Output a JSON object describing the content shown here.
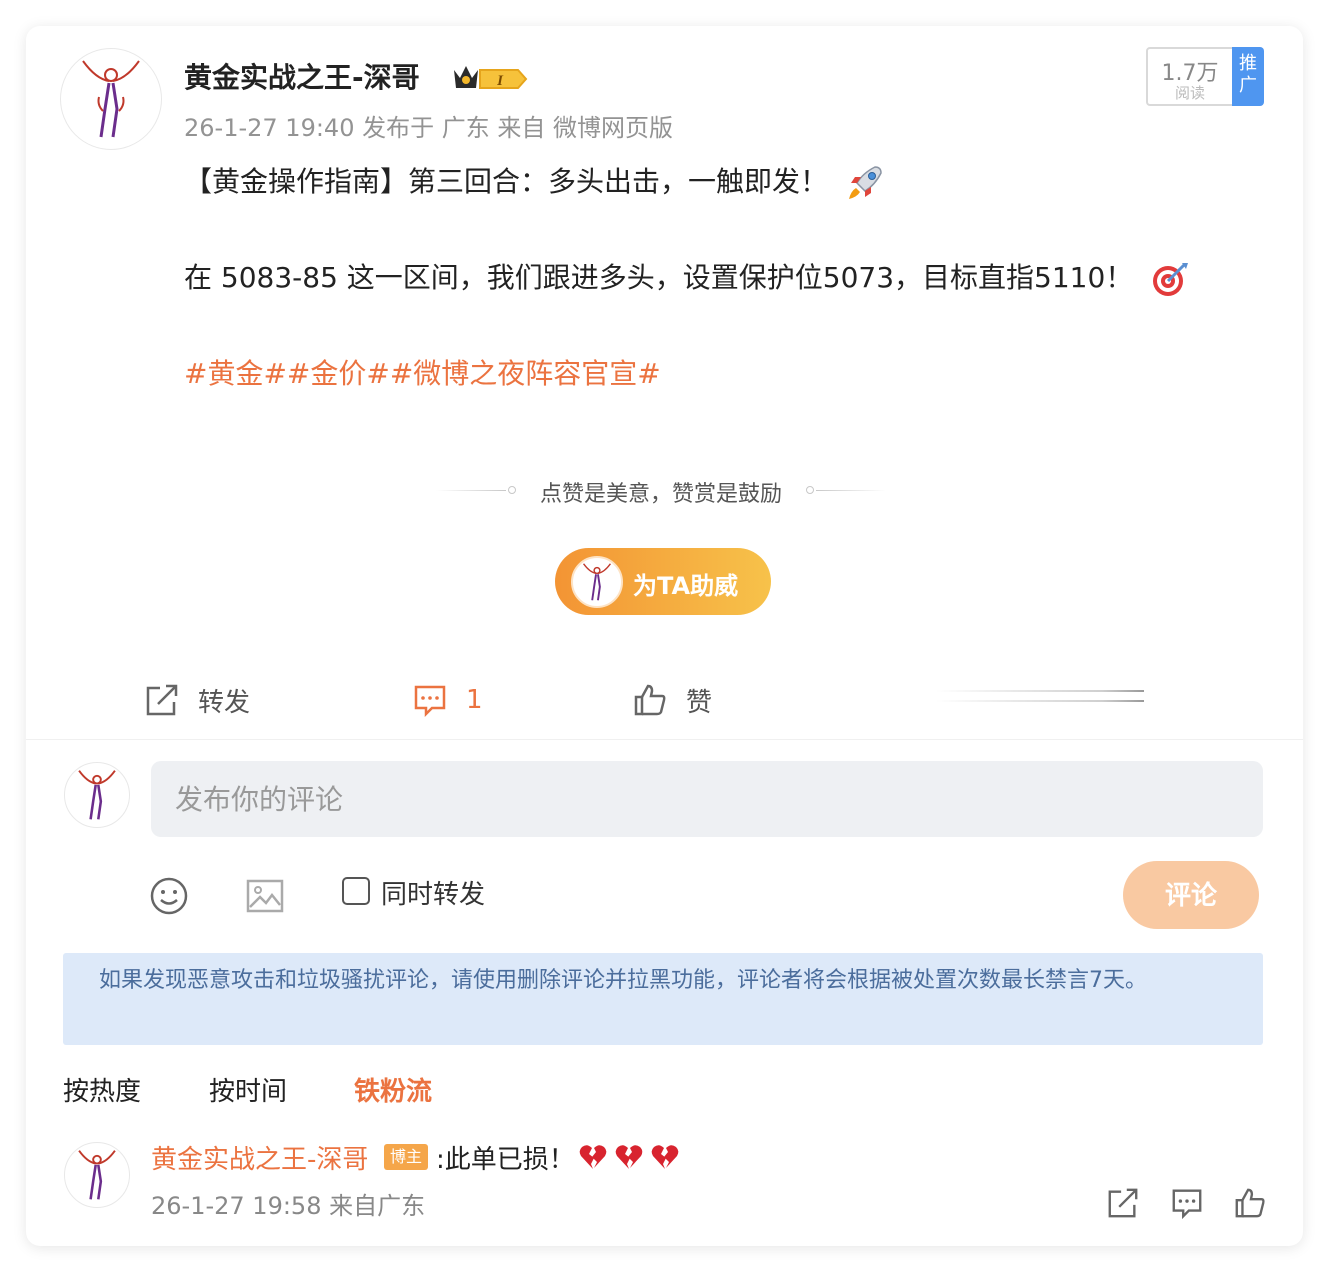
{
  "post": {
    "username": "黄金实战之王-深哥",
    "meta": "26-1-27 19:40  发布于 广东  来自 微博网页版",
    "read_count": "1.7万",
    "read_label": "阅读",
    "promo_tag": "推广",
    "line1": "【黄金操作指南】第三回合：多头出击，一触即发！",
    "line2": "在 5083-85 这一区间，我们跟进多头，设置保护位5073，目标直指5110！",
    "hashtags": "#黄金##金价##微博之夜阵容官宣#",
    "reward_text": "点赞是美意，赞赏是鼓励",
    "support_label": "为TA助威",
    "badge_level": "I"
  },
  "actions": {
    "repost_label": "转发",
    "comment_count": "1",
    "like_label": "赞"
  },
  "composer": {
    "placeholder": "发布你的评论",
    "repost_label": "同时转发",
    "submit_label": "评论"
  },
  "notice": "如果发现恶意攻击和垃圾骚扰评论，请使用删除评论并拉黑功能，评论者将会根据被处置次数最长禁言7天。",
  "sort_tabs": [
    "按热度",
    "按时间",
    "铁粉流"
  ],
  "reply": {
    "username": "黄金实战之王-深哥",
    "badge": "博主",
    "text": ":此单已损！",
    "meta": "26-1-27 19:58 来自广东"
  },
  "icons": {
    "rocket": "rocket-icon",
    "target": "target-icon",
    "broken_heart": "broken-heart-icon"
  },
  "colors": {
    "accent": "#eb7340",
    "promo_blue": "#4f96f0",
    "notice_bg": "#dde9f9",
    "notice_text": "#4b6d9c",
    "submit_disabled": "#f9c9a2"
  }
}
